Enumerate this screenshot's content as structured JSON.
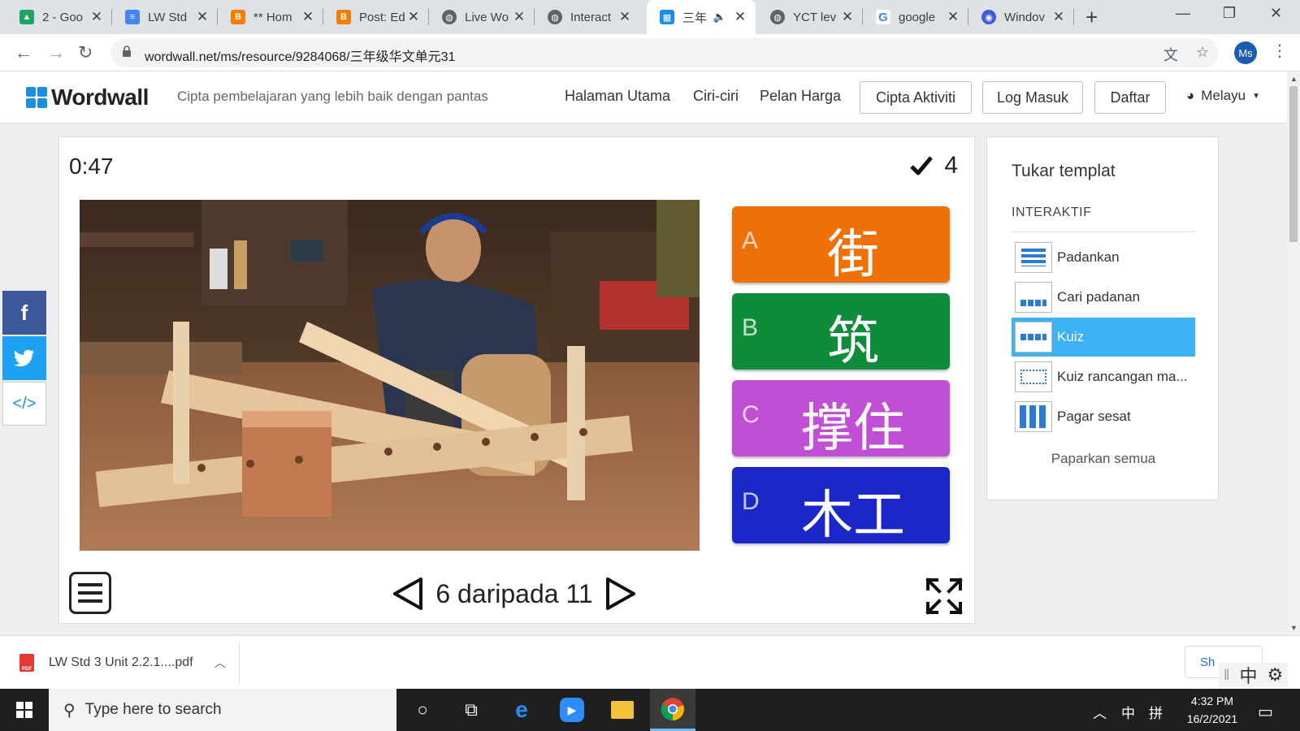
{
  "browser": {
    "tabs": [
      {
        "title": "2 - Goo",
        "icon": "google-drive-icon",
        "color": "#1fa463"
      },
      {
        "title": "LW Std",
        "icon": "google-docs-icon",
        "color": "#4285f4"
      },
      {
        "title": "** Hom",
        "icon": "blogger-icon",
        "color": "#f57d00"
      },
      {
        "title": "Post: Ed",
        "icon": "blogger-icon",
        "color": "#f57d00"
      },
      {
        "title": "Live Wo",
        "icon": "globe-icon",
        "color": "#5f6368"
      },
      {
        "title": "Interact",
        "icon": "globe-icon",
        "color": "#5f6368"
      },
      {
        "title": "三年",
        "icon": "wordwall-icon",
        "color": "#1d8fe0",
        "active": true
      },
      {
        "title": "YCT lev",
        "icon": "globe-icon",
        "color": "#5f6368"
      },
      {
        "title": "google",
        "icon": "google-icon",
        "color": "#4285f4"
      },
      {
        "title": "Windov",
        "icon": "windows-store-icon",
        "color": "#3b5bdb"
      }
    ],
    "url": "wordwall.net/ms/resource/9284068/三年级华文单元31",
    "profile_initials": "Ms"
  },
  "site": {
    "logo": "Wordwall",
    "tagline": "Cipta pembelajaran yang lebih baik dengan pantas",
    "nav": {
      "home": "Halaman Utama",
      "features": "Ciri-ciri",
      "pricing": "Pelan Harga"
    },
    "buttons": {
      "create": "Cipta Aktiviti",
      "login": "Log Masuk",
      "signup": "Daftar"
    },
    "language": "Melayu"
  },
  "social": [
    {
      "name": "facebook",
      "glyph": "f",
      "color": "#3b5998"
    },
    {
      "name": "twitter",
      "glyph": "🐦",
      "color": "#1da1f2"
    },
    {
      "name": "embed",
      "glyph": "</>",
      "color": "#ffffff"
    }
  ],
  "game": {
    "timer": "0:47",
    "score": "4",
    "answers": [
      {
        "letter": "A",
        "word": "街",
        "color": "#f07008"
      },
      {
        "letter": "B",
        "word": "筑",
        "color": "#0e8c3a"
      },
      {
        "letter": "C",
        "word": "撑住",
        "color": "#c04fd6"
      },
      {
        "letter": "D",
        "word": "木工",
        "color": "#1b28c7"
      }
    ],
    "pager": "6 daripada 11"
  },
  "templates": {
    "title": "Tukar templat",
    "category": "INTERAKTIF",
    "items": [
      {
        "label": "Padankan",
        "selected": false
      },
      {
        "label": "Cari padanan",
        "selected": false
      },
      {
        "label": "Kuiz",
        "selected": true
      },
      {
        "label": "Kuiz rancangan ma...",
        "selected": false
      },
      {
        "label": "Pagar sesat",
        "selected": false
      }
    ],
    "show_all": "Paparkan semua"
  },
  "downloads": {
    "file": "LW Std 3 Unit 2.2.1....pdf",
    "show_all": "Sh"
  },
  "ime": {
    "lang": "中"
  },
  "taskbar": {
    "search_placeholder": "Type here to search",
    "tray_lang": "中",
    "tray_ime": "拼",
    "time": "4:32 PM",
    "date": "16/2/2021"
  }
}
